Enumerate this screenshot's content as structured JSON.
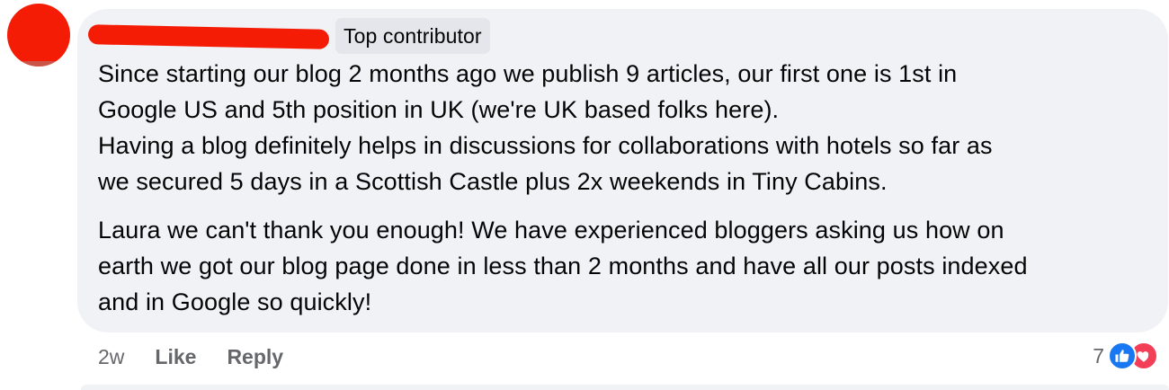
{
  "comment": {
    "author_badge": "Top contributor",
    "paragraphs": [
      [
        "Since starting our blog 2 months ago we publish 9 articles, our first one is 1st in",
        "Google US and 5th position in UK (we're UK based folks here).",
        "Having a blog definitely helps in discussions for collaborations with hotels so far as",
        "we secured 5 days in a Scottish Castle plus 2x weekends in Tiny Cabins."
      ],
      [
        "Laura we can't thank you enough! We have experienced bloggers asking us how on",
        "earth we got our blog page done in less than 2 months and have all our posts indexed",
        "and in Google so quickly!"
      ]
    ],
    "timestamp": "2w",
    "actions": {
      "like": "Like",
      "reply": "Reply"
    },
    "reactions": {
      "count": "7",
      "icons": [
        "like-icon",
        "love-icon"
      ],
      "colors": {
        "like": "#1877f2",
        "love": "#f33e58"
      }
    }
  }
}
